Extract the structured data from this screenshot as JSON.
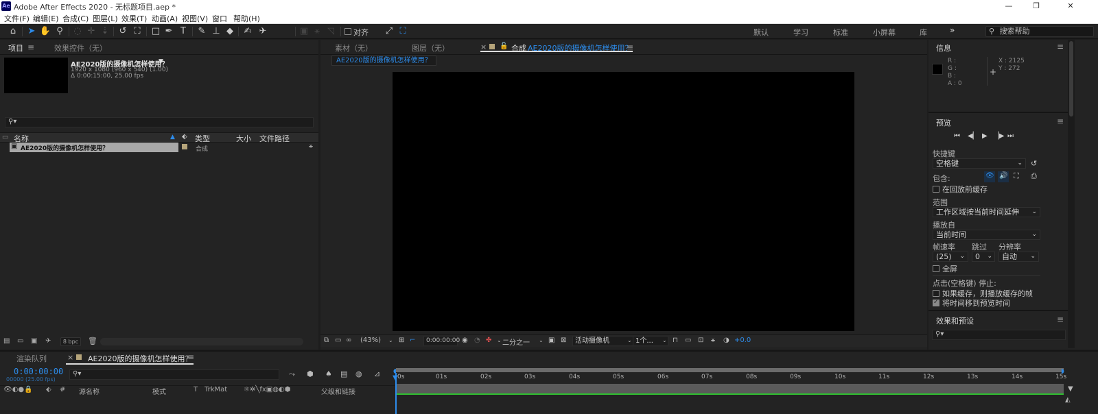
{
  "window": {
    "title": "Adobe After Effects 2020 - 无标题项目.aep *",
    "app_badge": "Ae",
    "minimize": "—",
    "restore": "❐",
    "close": "✕"
  },
  "menu": [
    "文件(F)",
    "编辑(E)",
    "合成(C)",
    "图层(L)",
    "效果(T)",
    "动画(A)",
    "视图(V)",
    "窗口",
    "帮助(H)"
  ],
  "toolbar": {
    "snap_label": "对齐",
    "workspaces": [
      "默认",
      "学习",
      "标准",
      "小屏幕",
      "库"
    ],
    "more": "»",
    "help_search_placeholder": "搜索帮助"
  },
  "project_panel": {
    "tab_project": "项目",
    "tab_effects": "效果控件（无）",
    "comp_name": "AE2020版的摄像机怎样使用？",
    "comp_info_1": "1920 x 1080  (960 x 540) (1.00)",
    "comp_info_2": "Δ 0:00:15:00, 25.00 fps",
    "columns": {
      "name": "名称",
      "type": "类型",
      "size": "大小",
      "path": "文件路径"
    },
    "items": [
      {
        "name": "AE2020版的摄像机怎样使用？",
        "type": "合成"
      }
    ],
    "bpc": "8 bpc"
  },
  "viewer": {
    "tab_footage": "素材（无）",
    "tab_layer": "图层（无）",
    "tab_comp_prefix": "合成",
    "tab_comp_name": "AE2020版的摄像机怎样使用？",
    "breadcrumb": "AE2020版的摄像机怎样使用？",
    "zoom": "(43%)",
    "timecode": "0:00:00:00",
    "resolution": "二分之一",
    "camera": "活动摄像机",
    "views": "1个...",
    "exposure": "+0.0"
  },
  "info_panel": {
    "title": "信息",
    "r": "R :",
    "g": "G :",
    "b": "B :",
    "a": "A : 0",
    "x": "X : 2125",
    "y": "Y : 272"
  },
  "preview_panel": {
    "title": "预览",
    "shortcut_label": "快捷键",
    "shortcut_value": "空格键",
    "include_label": "包含:",
    "cache_label": "在回放前缓存",
    "range_label": "范围",
    "range_value": "工作区域按当前时间延伸",
    "play_from_label": "播放自",
    "play_from_value": "当前时间",
    "fps_label": "帧速率",
    "skip_label": "跳过",
    "res_label": "分辨率",
    "fps_value": "(25)",
    "skip_value": "0",
    "res_value": "自动",
    "fullscreen_label": "全屏",
    "stop_label": "点击(空格键) 停止:",
    "opt1": "如果缓存，则播放缓存的帧",
    "opt2": "将时间移到预览时间",
    "fullscreen_checked": false,
    "opt1_checked": false,
    "opt2_checked": true
  },
  "effects_panel": {
    "title": "效果和预设"
  },
  "timeline": {
    "tab_render": "渲染队列",
    "tab_comp": "AE2020版的摄像机怎样使用？",
    "timecode": "0:00:00:00",
    "frame_info": "00000 (25.00 fps)",
    "columns": {
      "hash": "#",
      "source": "源名称",
      "mode": "模式",
      "t": "T",
      "trkmat": "TrkMat",
      "parent": "父级和链接"
    },
    "ruler": [
      "0s",
      "01s",
      "02s",
      "03s",
      "04s",
      "05s",
      "06s",
      "07s",
      "08s",
      "09s",
      "10s",
      "11s",
      "12s",
      "13s",
      "14s",
      "15s"
    ]
  },
  "colors": {
    "accent": "#2d8ceb",
    "panel": "#232323",
    "canvas": "#000000",
    "label_tan": "#b5a47a",
    "green_line": "#2fc02f"
  }
}
